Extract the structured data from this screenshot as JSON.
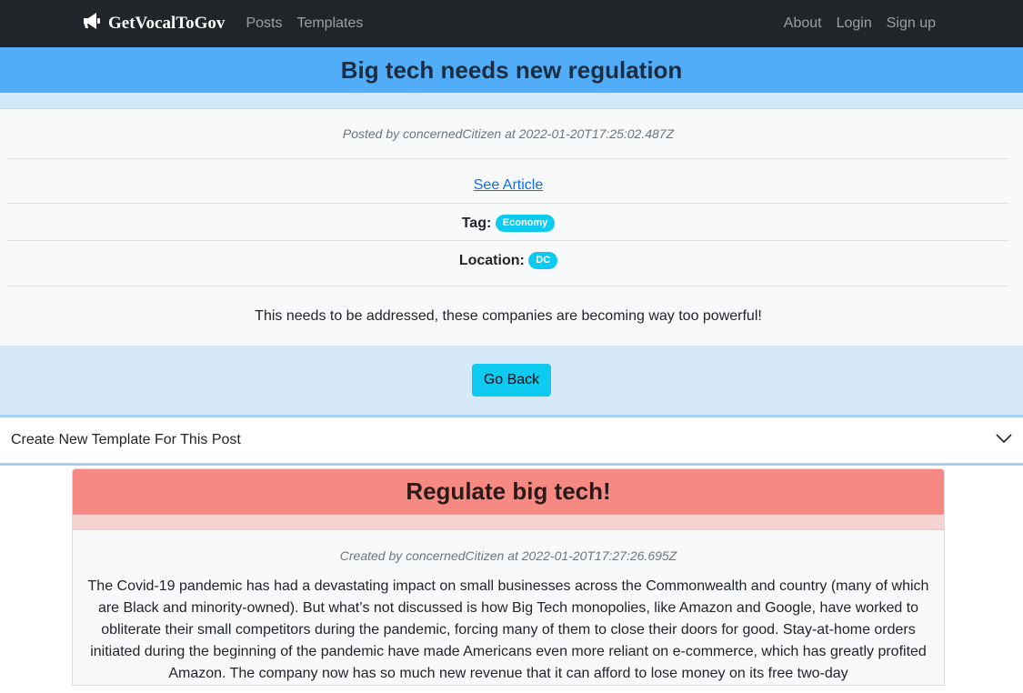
{
  "nav": {
    "brand": "GetVocalToGov",
    "links_left": [
      "Posts",
      "Templates"
    ],
    "links_right": [
      "About",
      "Login",
      "Sign up"
    ]
  },
  "post": {
    "title": "Big tech needs new regulation",
    "meta": "Posted by concernedCitizen at 2022-01-20T17:25:02.487Z",
    "article_link": "See Article",
    "tag_label": "Tag:",
    "tag": "Economy",
    "location_label": "Location:",
    "location": "DC",
    "body": "This needs to be addressed, these companies are becoming way too powerful!",
    "back_button": "Go Back"
  },
  "accordion": {
    "label": "Create New Template For This Post"
  },
  "template": {
    "title": "Regulate big tech!",
    "meta": "Created by concernedCitizen at 2022-01-20T17:27:26.695Z",
    "body": "The Covid-19 pandemic has had a devastating impact on small businesses across the Commonwealth and country (many of which are Black and minority-owned). But what’s not discussed is how Big Tech monopolies, like Amazon and Google, have worked to obliterate their small competitors during the pandemic, forcing many of them to close their doors for good. Stay-at-home orders initiated during the beginning of the pandemic have made Americans even more reliant on e-commerce, which has greatly profited Amazon. The company now has so much new revenue that it can afford to lose money on its free two-day"
  },
  "colors": {
    "navbar": "#212529",
    "post_header": "#52adf8",
    "template_header": "#f68a82",
    "badge": "#0dcaf0",
    "button": "#0dcaf0"
  },
  "icons": {
    "brand": "megaphone-icon",
    "accordion": "chevron-down-icon"
  }
}
